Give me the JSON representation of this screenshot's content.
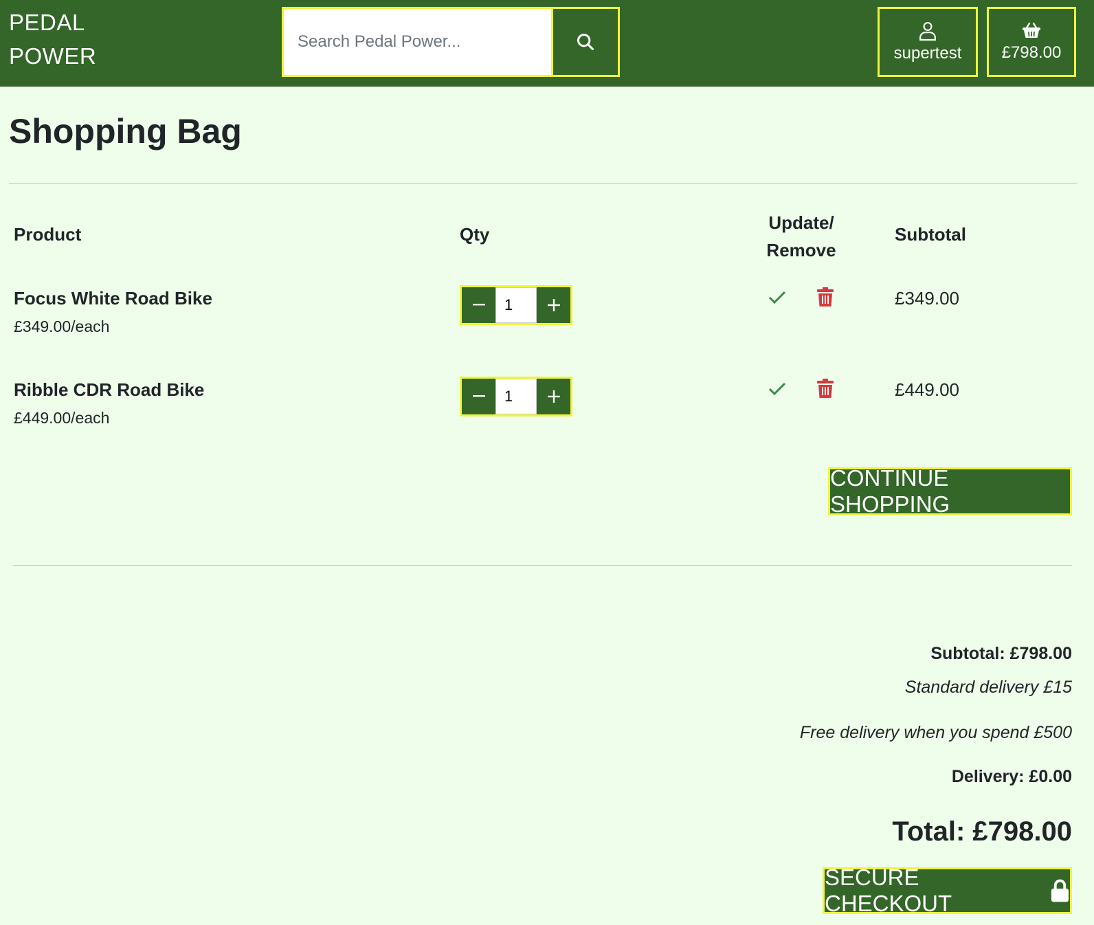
{
  "header": {
    "brand_line1": "PEDAL",
    "brand_line2": "POWER",
    "search_placeholder": "Search Pedal Power...",
    "account_label": "supertest",
    "bag_total": "£798.00"
  },
  "page": {
    "title": "Shopping Bag"
  },
  "table": {
    "col_product": "Product",
    "col_qty": "Qty",
    "col_update_line1": "Update/",
    "col_update_line2": "Remove",
    "col_subtotal": "Subtotal"
  },
  "items": [
    {
      "name": "Focus White Road Bike",
      "price_each": "£349.00/each",
      "qty": "1",
      "subtotal": "£349.00"
    },
    {
      "name": "Ribble CDR Road Bike",
      "price_each": "£449.00/each",
      "qty": "1",
      "subtotal": "£449.00"
    }
  ],
  "summary": {
    "subtotal": "Subtotal: £798.00",
    "standard_delivery": "Standard delivery £15",
    "free_delivery": "Free delivery when you spend £500",
    "delivery": "Delivery: £0.00",
    "total": "Total: £798.00"
  },
  "buttons": {
    "continue": "CONTINUE SHOPPING",
    "checkout": "SECURE CHECKOUT"
  },
  "colors": {
    "header_bg": "#336628",
    "page_bg": "#effeea",
    "outline": "#eef53b",
    "update_icon": "#3a8a4a",
    "remove_icon": "#d9383f"
  },
  "icons": {
    "search": "search-icon",
    "account": "user-icon",
    "bag": "basket-icon",
    "update": "check-icon",
    "remove": "trash-icon",
    "checkout": "lock-icon"
  }
}
